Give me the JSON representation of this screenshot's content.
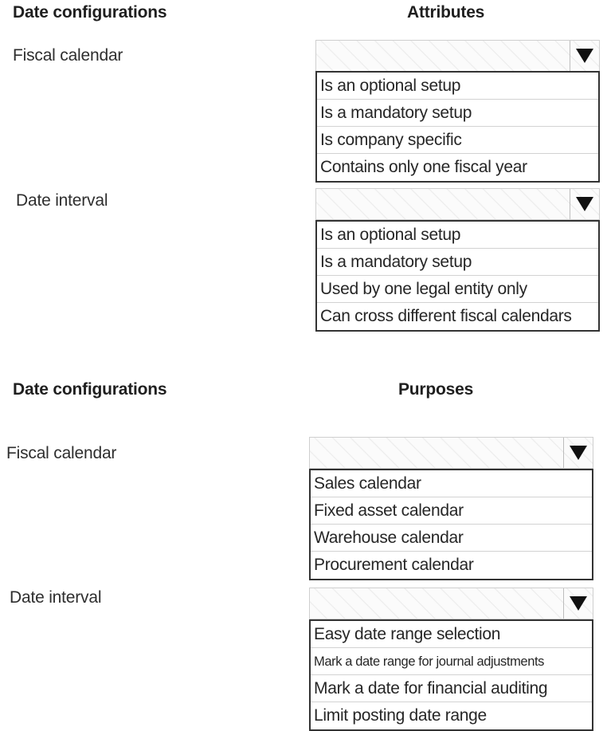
{
  "section1": {
    "left_heading": "Date configurations",
    "right_heading": "Attributes",
    "rows": [
      {
        "label": "Fiscal calendar",
        "selected": "",
        "options": [
          "Is an optional setup",
          "Is a mandatory setup",
          "Is company specific",
          "Contains only one fiscal year"
        ]
      },
      {
        "label": "Date interval",
        "selected": "",
        "options": [
          "Is an optional setup",
          "Is a mandatory setup",
          "Used by one legal entity only",
          "Can cross different fiscal calendars"
        ]
      }
    ]
  },
  "section2": {
    "left_heading": "Date configurations",
    "right_heading": "Purposes",
    "rows": [
      {
        "label": "Fiscal calendar",
        "selected": "",
        "options": [
          "Sales calendar",
          "Fixed asset calendar",
          "Warehouse calendar",
          "Procurement calendar"
        ]
      },
      {
        "label": "Date interval",
        "selected": "",
        "options": [
          "Easy date range selection",
          "Mark a date range for journal adjustments",
          "Mark a date for financial auditing",
          "Limit posting date range"
        ]
      }
    ]
  },
  "icons": {
    "dropdown": "triangle-down"
  }
}
